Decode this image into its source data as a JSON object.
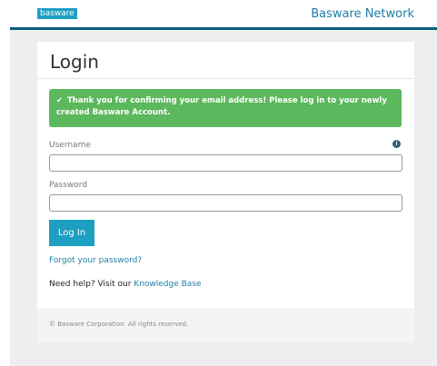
{
  "header": {
    "logo_text": "basware",
    "network_link": "Basware Network"
  },
  "login": {
    "title": "Login",
    "alert_message": "Thank you for confirming your email address! Please log in to your newly created Basware Account.",
    "username_label": "Username",
    "username_value": "",
    "password_label": "Password",
    "password_value": "",
    "submit_label": "Log In",
    "forgot_link": "Forgot your password?",
    "help_prefix": "Need help? Visit our",
    "knowledge_base_link": "Knowledge Base"
  },
  "footer": {
    "copyright": "© Basware Corporation. All rights reserved."
  },
  "colors": {
    "brand": "#1d9fc2",
    "header_bar": "#0d5b7e",
    "success": "#5cb85c"
  },
  "icons": [
    "check-icon",
    "info-icon"
  ]
}
